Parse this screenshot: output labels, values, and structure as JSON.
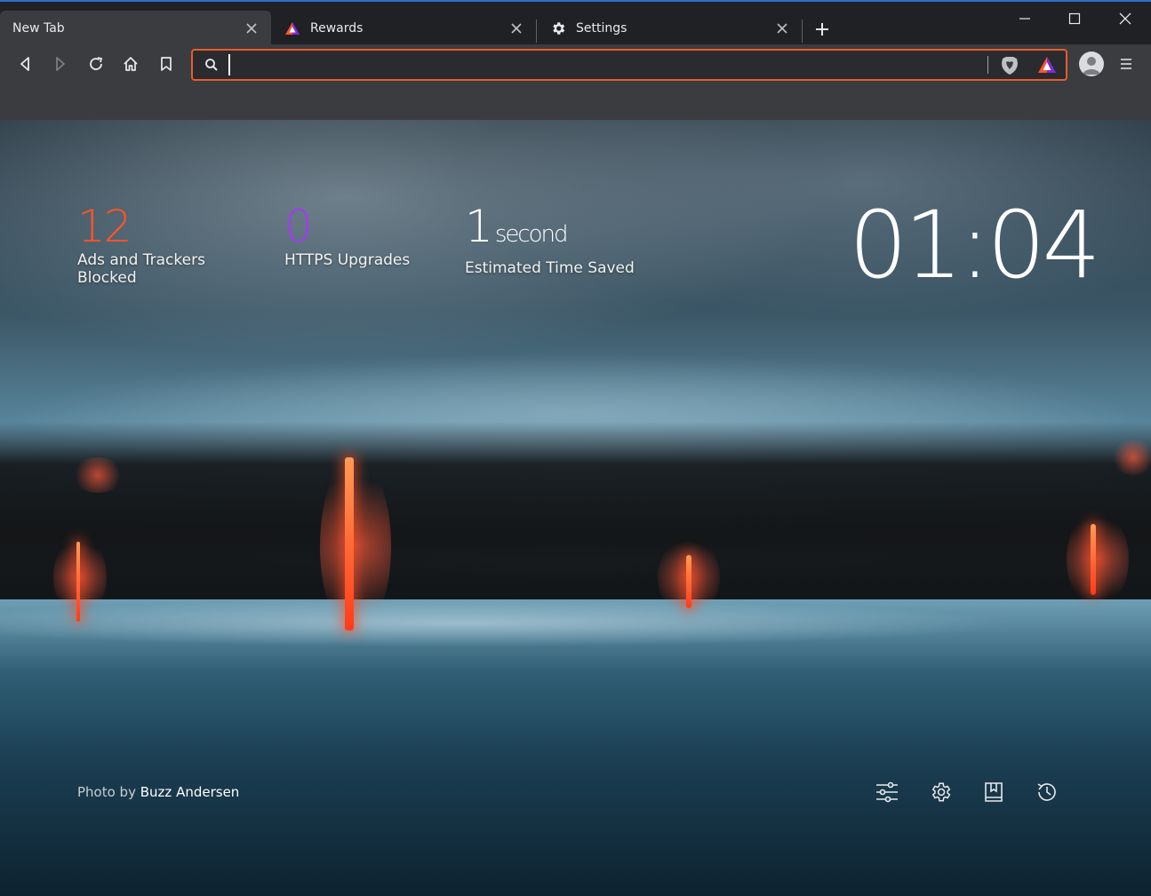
{
  "tabs": [
    {
      "title": "New Tab",
      "active": true,
      "icon": "none"
    },
    {
      "title": "Rewards",
      "active": false,
      "icon": "brave-rewards-icon"
    },
    {
      "title": "Settings",
      "active": false,
      "icon": "gear-icon"
    }
  ],
  "toolbar": {
    "address_value": "",
    "address_placeholder": ""
  },
  "stats": {
    "ads_blocked": {
      "value": "12",
      "label": "Ads and Trackers Blocked",
      "color": "#fb542b"
    },
    "https_upgrades": {
      "value": "0",
      "label": "HTTPS Upgrades",
      "color": "#a33cf0"
    },
    "time_saved": {
      "value": "1",
      "unit": "second",
      "label": "Estimated Time Saved",
      "color": "#ffffff"
    }
  },
  "clock": "01:04",
  "credit": {
    "prefix": "Photo by",
    "author": "Buzz Andersen"
  },
  "colors": {
    "accent": "#e85c2c",
    "tab_strip": "#202124",
    "toolbar": "#3b3c3f"
  }
}
